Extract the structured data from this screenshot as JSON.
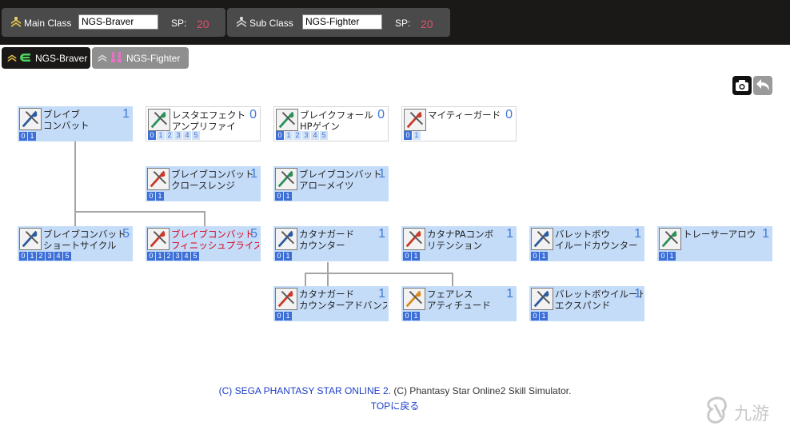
{
  "main_class": {
    "label": "Main Class",
    "value": "NGS-Braver",
    "sp_label": "SP:",
    "sp_value": "20"
  },
  "sub_class": {
    "label": "Sub  Class",
    "value": "NGS-Fighter",
    "sp_label": "SP:",
    "sp_value": "20"
  },
  "tabs": [
    {
      "label": "NGS-Braver",
      "active": true
    },
    {
      "label": "NGS-Fighter",
      "active": false
    }
  ],
  "tools": {
    "camera_icon": "camera-icon",
    "undo_icon": "undo-arrow-icon"
  },
  "skills": [
    {
      "name": "ブレイブ\nコンバット",
      "level": "1",
      "levels": [
        "0",
        "1"
      ],
      "selected": 1,
      "lit": true,
      "icon": "brave-combat-icon",
      "color": "#2d5c9e"
    },
    {
      "name": "レスタエフェクト\nアンプリファイ",
      "level": "0",
      "levels": [
        "0",
        "1",
        "2",
        "3",
        "4",
        "5"
      ],
      "selected": 0,
      "lit": false,
      "icon": "resta-effect-icon",
      "color": "#2e8f5a"
    },
    {
      "name": "ブレイクフォール\nHPゲイン",
      "level": "0",
      "levels": [
        "0",
        "1",
        "2",
        "3",
        "4",
        "5"
      ],
      "selected": 0,
      "lit": false,
      "icon": "breakfall-icon",
      "color": "#2e8f5a"
    },
    {
      "name": "マイティーガード",
      "level": "0",
      "levels": [
        "0",
        "1"
      ],
      "selected": 0,
      "lit": false,
      "icon": "mighty-guard-icon",
      "color": "#c83a2a"
    },
    {
      "name": "ブレイブコンバット\nクロースレンジ",
      "level": "1",
      "levels": [
        "0",
        "1"
      ],
      "selected": 1,
      "lit": true,
      "icon": "close-range-icon",
      "color": "#c83a2a"
    },
    {
      "name": "ブレイブコンバット\nアローメイツ",
      "level": "1",
      "levels": [
        "0",
        "1"
      ],
      "selected": 1,
      "lit": true,
      "icon": "arrow-mates-icon",
      "color": "#2e8f5a"
    },
    {
      "name": "ブレイブコンバット\nショートサイクル",
      "level": "5",
      "levels": [
        "0",
        "1",
        "2",
        "3",
        "4",
        "5"
      ],
      "selected": 5,
      "lit": true,
      "icon": "short-cycle-icon",
      "color": "#2d5c9e"
    },
    {
      "name": "ブレイブコンバット\nフィニッシュプライズ",
      "level": "5",
      "levels": [
        "0",
        "1",
        "2",
        "3",
        "4",
        "5"
      ],
      "selected": 5,
      "lit": true,
      "red": true,
      "icon": "finish-prize-icon",
      "color": "#c83a2a"
    },
    {
      "name": "カタナガード\nカウンター",
      "level": "1",
      "levels": [
        "0",
        "1"
      ],
      "selected": 1,
      "lit": true,
      "icon": "katana-guard-counter-icon",
      "color": "#2d5c9e"
    },
    {
      "name": "カタナPAコンボ\nリテンション",
      "level": "1",
      "levels": [
        "0",
        "1"
      ],
      "selected": 1,
      "lit": true,
      "icon": "katana-pa-combo-icon",
      "color": "#c83a2a"
    },
    {
      "name": "バレットボウ\nイルードカウンター",
      "level": "1",
      "levels": [
        "0",
        "1"
      ],
      "selected": 1,
      "lit": true,
      "icon": "bullet-bow-counter-icon",
      "color": "#2d5c9e"
    },
    {
      "name": "トレーサーアロウ",
      "level": "1",
      "levels": [
        "0",
        "1"
      ],
      "selected": 1,
      "lit": true,
      "icon": "tracer-arrow-icon",
      "color": "#2e8f5a"
    },
    {
      "name": "カタナガード\nカウンターアドバンス",
      "level": "1",
      "levels": [
        "0",
        "1"
      ],
      "selected": 1,
      "lit": true,
      "icon": "katana-counter-advance-icon",
      "color": "#c83a2a"
    },
    {
      "name": "フェアレス\nアティチュード",
      "level": "1",
      "levels": [
        "0",
        "1"
      ],
      "selected": 1,
      "lit": true,
      "icon": "fearless-attitude-icon",
      "color": "#d98a1a"
    },
    {
      "name": "バレットボウイルード\nエクスパンド",
      "level": "1",
      "levels": [
        "0",
        "1"
      ],
      "selected": 1,
      "lit": true,
      "icon": "bullet-bow-expand-icon",
      "color": "#2d5c9e"
    }
  ],
  "footer": {
    "copyright_sega": "(C)  SEGA   PHANTASY STAR ONLINE 2.",
    "copyright_sim": " (C)  Phantasy Star Online2 Skill Simulator.",
    "top_link": "TOPに戻る"
  },
  "watermark": {
    "text": "九游"
  },
  "colors": {
    "bar": "#1b1917",
    "class_box": "#4a4a4a",
    "tab_active": "#1b1917",
    "tab_inactive": "#8f8f8f",
    "node_lit": "#c4dcf8",
    "level_on": "#3d6fd8",
    "level_text": "#3f79d4",
    "sp": "#e0506a",
    "link": "#1b3ec9",
    "red_name": "#d9001a"
  }
}
